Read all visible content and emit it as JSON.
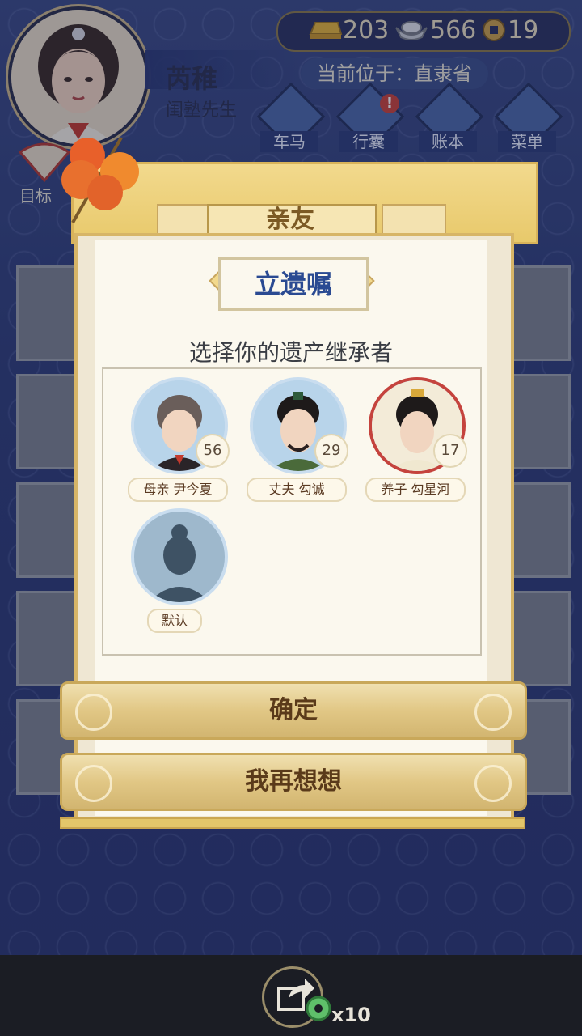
{
  "player": {
    "name": "芮稚",
    "title": "闺塾先生"
  },
  "currency": {
    "gold": "203",
    "silver": "566",
    "coins": "19"
  },
  "location_text": "当前位于：直隶省",
  "nav": [
    {
      "label": "车马",
      "icon": "carriage-icon"
    },
    {
      "label": "行囊",
      "icon": "bag-icon"
    },
    {
      "label": "账本",
      "icon": "ledger-icon"
    },
    {
      "label": "菜单",
      "icon": "menu-dots-icon"
    }
  ],
  "goal_label": "目标",
  "dialog": {
    "tab_title": "亲友",
    "will_title": "立遗嘱",
    "subtitle": "选择你的遗产继承者",
    "heirs": [
      {
        "label": "母亲 尹今夏",
        "age": "56"
      },
      {
        "label": "丈夫 勾诚",
        "age": "29"
      },
      {
        "label": "养子 勾星河",
        "age": "17"
      },
      {
        "label": "默认",
        "age": ""
      }
    ],
    "confirm_label": "确定",
    "reconsider_label": "我再想想"
  },
  "bottom": {
    "reward_count": "x10"
  },
  "colors": {
    "accent_blue": "#2a4a92",
    "gold": "#e3c66a",
    "alert": "#c9423a"
  }
}
